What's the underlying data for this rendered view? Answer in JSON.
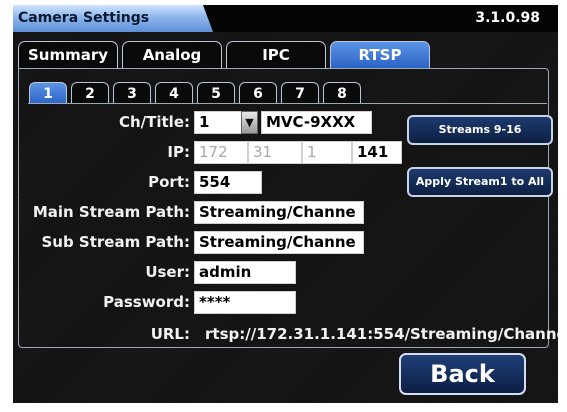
{
  "app": {
    "title": "Camera Settings",
    "version": "3.1.0.98"
  },
  "tabs": [
    {
      "label": "Summary"
    },
    {
      "label": "Analog"
    },
    {
      "label": "IPC"
    },
    {
      "label": "RTSP"
    }
  ],
  "active_tab": "RTSP",
  "stream_tabs": [
    {
      "label": "1"
    },
    {
      "label": "2"
    },
    {
      "label": "3"
    },
    {
      "label": "4"
    },
    {
      "label": "5"
    },
    {
      "label": "6"
    },
    {
      "label": "7"
    },
    {
      "label": "8"
    }
  ],
  "active_stream_tab": "1",
  "form": {
    "ch_title_label": "Ch/Title:",
    "channel_value": "1",
    "title_value": "MVC-9XXX",
    "ip_label": "IP:",
    "ip_octets": [
      "172",
      "31",
      "1",
      "141"
    ],
    "port_label": "Port:",
    "port_value": "554",
    "main_path_label": "Main Stream Path:",
    "main_path_value": "Streaming/Channe",
    "sub_path_label": "Sub Stream Path:",
    "sub_path_value": "Streaming/Channe",
    "user_label": "User:",
    "user_value": "admin",
    "password_label": "Password:",
    "password_value": "****",
    "url_label": "URL:",
    "url_value": "rtsp://172.31.1.141:554/Streaming/Channe"
  },
  "buttons": {
    "streams_label": "Streams 9-16",
    "apply_label": "Apply Stream1 to All",
    "back_label": "Back"
  },
  "icons": {
    "dropdown": "chevron-down-icon"
  },
  "colors": {
    "accent": "#3a78d8",
    "background": "#121212",
    "field": "#ffffff"
  }
}
